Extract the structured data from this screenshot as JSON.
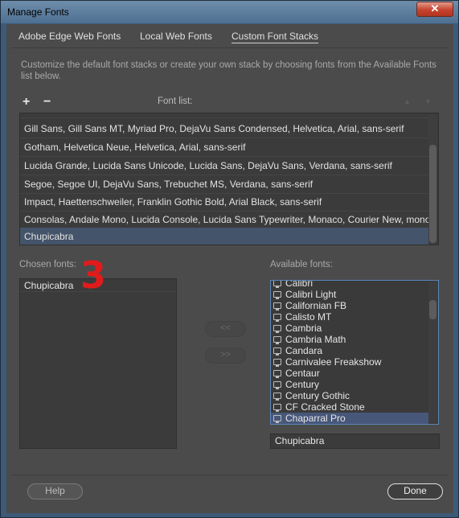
{
  "window": {
    "title": "Manage Fonts",
    "close_label": "✕"
  },
  "tabs": [
    {
      "label": "Adobe Edge Web Fonts"
    },
    {
      "label": "Local Web Fonts"
    },
    {
      "label": "Custom Font Stacks",
      "active": true
    }
  ],
  "description": "Customize the default font stacks or create your own stack by choosing fonts from the Available Fonts list below.",
  "toolbar": {
    "add_label": "+",
    "remove_label": "−",
    "font_list_label": "Font list:",
    "up_label": "▲",
    "down_label": "▼"
  },
  "font_list": {
    "rows": [
      "Gill Sans, Gill Sans MT, Myriad Pro, DejaVu Sans Condensed, Helvetica, Arial, sans-serif",
      "Gotham, Helvetica Neue, Helvetica, Arial, sans-serif",
      "Lucida Grande, Lucida Sans Unicode, Lucida Sans, DejaVu Sans, Verdana, sans-serif",
      "Segoe, Segoe UI, DejaVu Sans, Trebuchet MS, Verdana, sans-serif",
      "Impact, Haettenschweiler, Franklin Gothic Bold, Arial Black, sans-serif",
      "Consolas, Andale Mono, Lucida Console, Lucida Sans Typewriter, Monaco, Courier New, monos...",
      "Chupicabra"
    ],
    "selected_index": 6
  },
  "chosen": {
    "label": "Chosen fonts:",
    "items": [
      "Chupicabra"
    ],
    "marker": "3"
  },
  "move_buttons": {
    "add_label": "<<",
    "remove_label": ">>"
  },
  "available": {
    "label": "Available fonts:",
    "items": [
      "Calibri",
      "Calibri Light",
      "Californian FB",
      "Calisto MT",
      "Cambria",
      "Cambria Math",
      "Candara",
      "Carnivalee Freakshow",
      "Centaur",
      "Century",
      "Century Gothic",
      "CF Cracked Stone",
      "Chaparral Pro"
    ],
    "selected_index": 12,
    "icon": "monitor-icon"
  },
  "name_input": {
    "value": "Chupicabra"
  },
  "footer": {
    "help_label": "Help",
    "done_label": "Done"
  }
}
